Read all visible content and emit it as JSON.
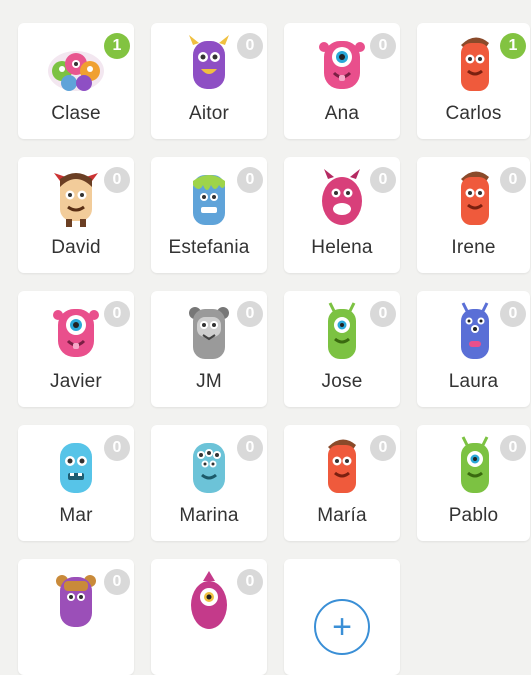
{
  "students": [
    {
      "name": "Clase",
      "points": "1",
      "positive": true,
      "avatar": "class-group",
      "color": "#e8568f"
    },
    {
      "name": "Aitor",
      "points": "0",
      "positive": false,
      "avatar": "purple-horned-monster",
      "color": "#8e4fc4"
    },
    {
      "name": "Ana",
      "points": "0",
      "positive": false,
      "avatar": "pink-one-eyed-monster",
      "color": "#e94f8c"
    },
    {
      "name": "Carlos",
      "points": "1",
      "positive": true,
      "avatar": "red-monster",
      "color": "#ef5a3c"
    },
    {
      "name": "David",
      "points": "0",
      "positive": false,
      "avatar": "brown-horned-monster",
      "color": "#8a5a3b"
    },
    {
      "name": "Estefania",
      "points": "0",
      "positive": false,
      "avatar": "blue-slime-monster",
      "color": "#5fa3d9"
    },
    {
      "name": "Helena",
      "points": "0",
      "positive": false,
      "avatar": "pink-horned-monster",
      "color": "#d83f7a"
    },
    {
      "name": "Irene",
      "points": "0",
      "positive": false,
      "avatar": "red-monster",
      "color": "#ef5a3c"
    },
    {
      "name": "Javier",
      "points": "0",
      "positive": false,
      "avatar": "pink-one-eyed-monster",
      "color": "#e94f8c"
    },
    {
      "name": "JM",
      "points": "0",
      "positive": false,
      "avatar": "grey-monster",
      "color": "#9a9a9a"
    },
    {
      "name": "Jose",
      "points": "0",
      "positive": false,
      "avatar": "green-one-eyed-monster",
      "color": "#7cc242"
    },
    {
      "name": "Laura",
      "points": "0",
      "positive": false,
      "avatar": "blue-many-eyed-monster",
      "color": "#5a6fd6"
    },
    {
      "name": "Mar",
      "points": "0",
      "positive": false,
      "avatar": "cyan-monster",
      "color": "#57c4e8"
    },
    {
      "name": "Marina",
      "points": "0",
      "positive": false,
      "avatar": "teal-many-eyed-monster",
      "color": "#6cc3d8"
    },
    {
      "name": "María",
      "points": "0",
      "positive": false,
      "avatar": "red-monster",
      "color": "#ef5a3c"
    },
    {
      "name": "Pablo",
      "points": "0",
      "positive": false,
      "avatar": "green-one-eyed-monster",
      "color": "#7cc242"
    },
    {
      "name": "",
      "points": "0",
      "positive": false,
      "avatar": "purple-bear-monster",
      "color": "#9b4fb8"
    },
    {
      "name": "",
      "points": "0",
      "positive": false,
      "avatar": "magenta-one-eyed-monster",
      "color": "#c43a8a"
    }
  ],
  "add_button": {
    "label": "+",
    "icon": "plus-icon"
  },
  "colors": {
    "positive_badge": "#82c341",
    "neutral_badge": "#d9d9d9",
    "accent": "#3a8fd6"
  }
}
